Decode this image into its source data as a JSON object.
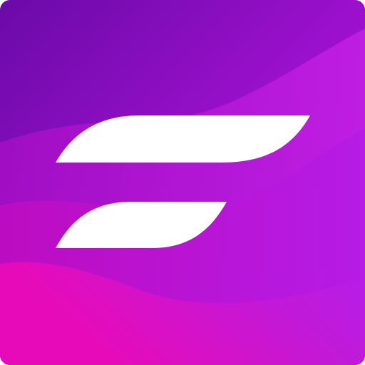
{
  "icon": {
    "name": "app-logo-icon",
    "motif": "two-stacked-wing-strokes",
    "colors": {
      "gradient_top_left": "#6a0aa8",
      "gradient_mid": "#9b10cc",
      "gradient_right": "#b61de6",
      "gradient_bottom_left": "#e70ab8",
      "wave_light": "#c018dc",
      "mark": "#ffffff"
    }
  }
}
